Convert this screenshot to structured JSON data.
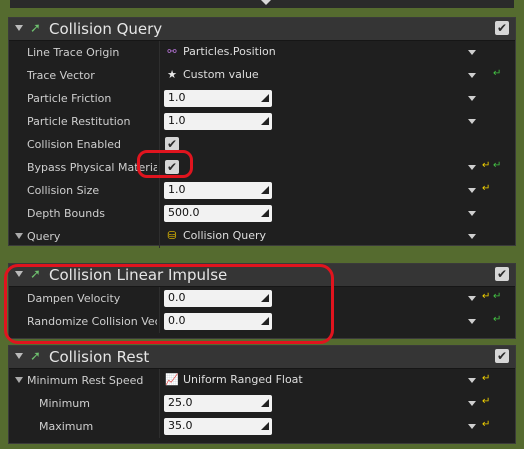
{
  "sections": {
    "query": {
      "title": "Collision Query",
      "rows": [
        {
          "label": "Line Trace Origin",
          "value": "Particles.Position",
          "icon": "link-icon"
        },
        {
          "label": "Trace Vector",
          "value": "Custom value",
          "icon": "star-icon"
        },
        {
          "label": "Particle Friction",
          "value": "1.0"
        },
        {
          "label": "Particle Restitution",
          "value": "1.0"
        },
        {
          "label": "Collision Enabled",
          "checked": true
        },
        {
          "label": "Bypass Physical Materia",
          "checked": true
        },
        {
          "label": "Collision Size",
          "value": "1.0"
        },
        {
          "label": "Depth Bounds",
          "value": "500.0"
        },
        {
          "label": "Query",
          "value": "Collision Query",
          "icon": "database-icon"
        }
      ]
    },
    "impulse": {
      "title": "Collision Linear Impulse",
      "rows": [
        {
          "label": "Dampen Velocity",
          "value": "0.0"
        },
        {
          "label": "Randomize Collision Vect",
          "value": "0.0"
        }
      ]
    },
    "rest": {
      "title": "Collision Rest",
      "rows": [
        {
          "label": "Minimum Rest Speed",
          "value": "Uniform Ranged Float",
          "icon": "curve-icon"
        },
        {
          "label": "Minimum",
          "value": "25.0"
        },
        {
          "label": "Maximum",
          "value": "35.0"
        }
      ]
    }
  },
  "colors": {
    "highlight": "#e0141e",
    "accent_green": "#6ec06e",
    "reset_yellow": "#f0d000"
  }
}
